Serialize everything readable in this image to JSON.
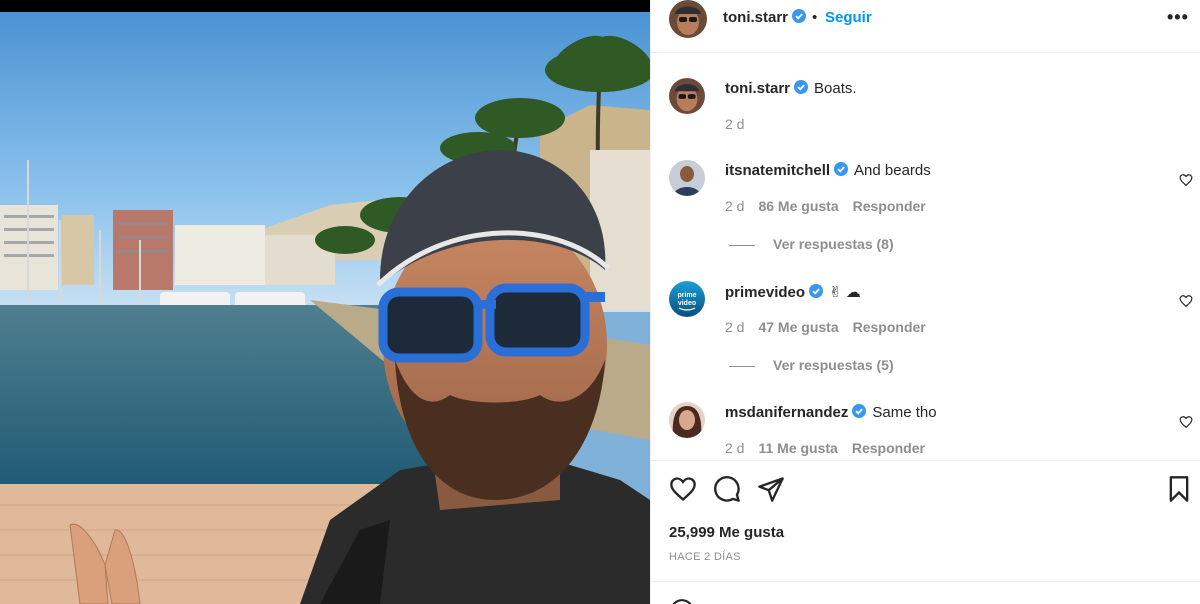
{
  "post": {
    "username": "toni.starr",
    "separator": "•",
    "follow_label": "Seguir",
    "more_label": "•••",
    "caption": "Boats.",
    "caption_age": "2 d",
    "likes": "25,999 Me gusta",
    "date": "HACE 2 DÍAS"
  },
  "comments": [
    {
      "username": "itsnatemitchell",
      "text": "And beards",
      "age": "2 d",
      "likes": "86 Me gusta",
      "reply": "Responder",
      "view_replies": "Ver respuestas (8)"
    },
    {
      "username": "primevideo",
      "text": "✌ ☁",
      "age": "2 d",
      "likes": "47 Me gusta",
      "reply": "Responder",
      "view_replies": "Ver respuestas (5)"
    },
    {
      "username": "msdanifernandez",
      "text": "Same tho",
      "age": "2 d",
      "likes": "11 Me gusta",
      "reply": "Responder"
    }
  ],
  "icons": [
    "heart-icon",
    "comment-icon",
    "share-icon",
    "bookmark-icon",
    "verified-icon",
    "emoji-icon"
  ],
  "colors": {
    "accent": "#0095f6",
    "verified": "#3897f0",
    "muted": "#8e8e8e",
    "text": "#262626",
    "border": "#efefef"
  }
}
